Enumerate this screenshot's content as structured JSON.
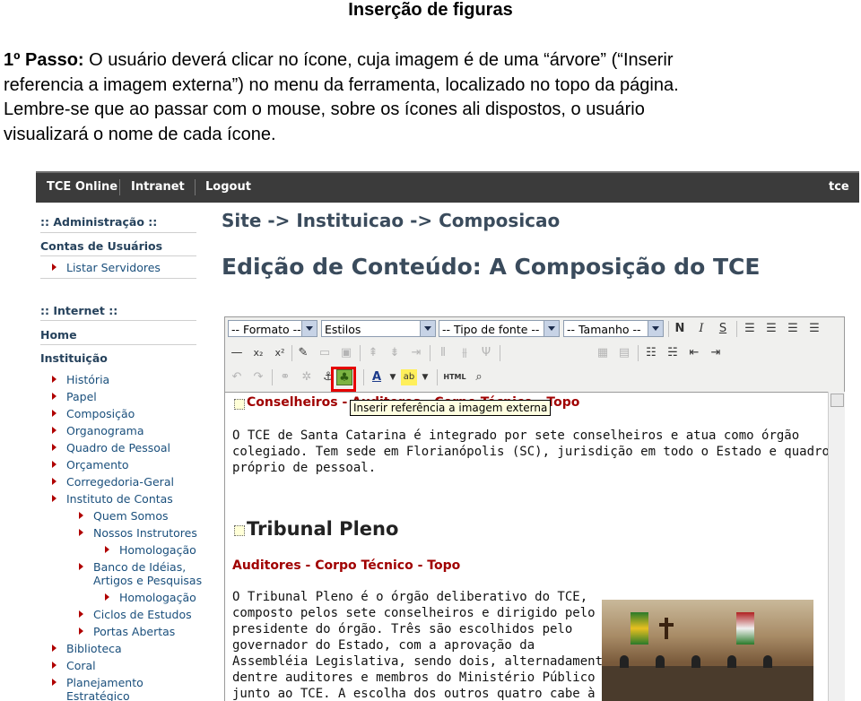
{
  "doc": {
    "title": "Inserção de figuras",
    "step_label": "1º Passo:",
    "lines": [
      "O usuário deverá clicar no ícone, cuja imagem é de uma “árvore” (“Inserir",
      "referencia a imagem externa”) no menu da ferramenta, localizado no topo da página.",
      "Lembre-se que ao passar com o mouse, sobre os ícones ali dispostos, o usuário",
      "visualizará o nome de cada ícone."
    ]
  },
  "topnav": {
    "items": [
      "TCE Online",
      "Intranet",
      "Logout"
    ],
    "right": "tce"
  },
  "sidebar": {
    "admin_header": ":: Administração ::",
    "contas": "Contas de Usuários",
    "listar": "Listar Servidores",
    "internet_header": ":: Internet ::",
    "home": "Home",
    "instituicao": "Instituição",
    "items": [
      "História",
      "Papel",
      "Composição",
      "Organograma",
      "Quadro de Pessoal",
      "Orçamento",
      "Corregedoria-Geral",
      "Instituto de Contas"
    ],
    "sub_items": [
      "Quem Somos",
      "Nossos Instrutores"
    ],
    "homologacao": "Homologação",
    "banco_line1": "Banco de Idéias,",
    "banco_line2": "Artigos e Pesquisas",
    "homologacao2": "Homologação",
    "ciclos": "Ciclos de Estudos",
    "portas": "Portas Abertas",
    "tail": [
      "Biblioteca",
      "Coral",
      "Planejamento"
    ],
    "tail_cut": "Estratégico"
  },
  "page": {
    "breadcrumb": "Site -> Instituicao -> Composicao",
    "title": "Edição de Conteúdo: A Composição do TCE"
  },
  "editor": {
    "dropdowns": [
      "-- Formato --",
      "Estilos",
      "-- Tipo de fonte --",
      "-- Tamanho --"
    ],
    "tooltip": "Inserir referência a imagem externa",
    "heading_link": "Conselheiros - Auditores - Corpo Técnico - Topo",
    "para1": [
      "O TCE de Santa Catarina é integrado por sete conselheiros e atua como órgão",
      "colegiado. Tem sede em Florianópolis (SC), jurisdição em todo o Estado e quadro",
      "próprio de pessoal."
    ],
    "big_heading": "Tribunal Pleno",
    "sub_link": "Auditores - Corpo Técnico - Topo",
    "para2": [
      "O Tribunal Pleno é o órgão deliberativo do TCE,",
      "composto pelos sete conselheiros e dirigido pelo",
      "presidente do órgão. Três são escolhidos pelo",
      "governador do Estado, com a aprovação da",
      "Assembléia Legislativa, sendo dois, alternadamente,",
      "dentre auditores e membros do Ministério Público",
      "junto ao TCE. A escolha dos outros quatro cabe à"
    ]
  },
  "colors": {
    "nav_bg": "#3b3b3b",
    "heading": "#3a4b5c",
    "red": "#a00000",
    "highlight": "#e60000"
  }
}
